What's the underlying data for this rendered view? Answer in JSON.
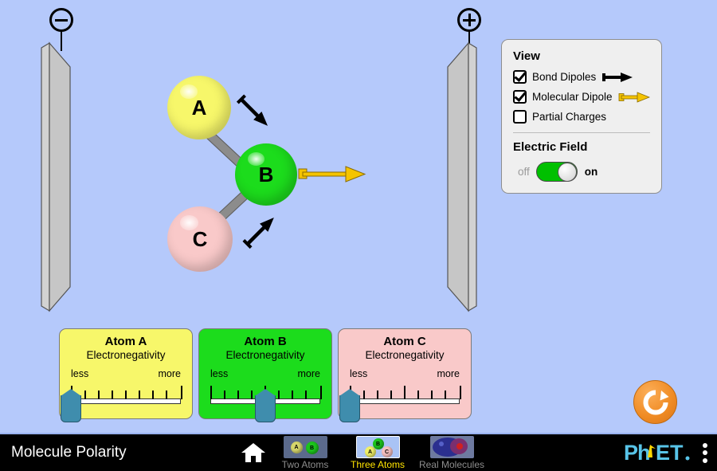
{
  "app": {
    "title": "Molecule Polarity",
    "background_color": "#b5c9fb"
  },
  "field": {
    "negative_plate_sign": "minus-sign",
    "positive_plate_sign": "plus-sign",
    "plate_color": "#c6c6c6"
  },
  "molecule": {
    "atoms": [
      {
        "label": "A",
        "color": "#f7f76a",
        "name": "atom-a"
      },
      {
        "label": "B",
        "color": "#1cdc1c",
        "name": "atom-b"
      },
      {
        "label": "C",
        "color": "#f9c9c9",
        "name": "atom-c"
      }
    ],
    "bond_dipole_color": "#000000",
    "molecular_dipole_color": "#f0b800"
  },
  "view_panel": {
    "title": "View",
    "checkboxes": [
      {
        "label": "Bond Dipoles",
        "checked": true,
        "icon": "bond-dipole-arrow-icon"
      },
      {
        "label": "Molecular Dipole",
        "checked": true,
        "icon": "molecular-dipole-arrow-icon"
      },
      {
        "label": "Partial Charges",
        "checked": false,
        "icon": "none"
      }
    ],
    "electric_field": {
      "title": "Electric Field",
      "off_label": "off",
      "on_label": "on",
      "state": "on"
    }
  },
  "electronegativity_controls": [
    {
      "title": "Atom A",
      "subtitle": "Electronegativity",
      "less_label": "less",
      "more_label": "more",
      "value_percent": 0,
      "panel_color": "#f7f76a",
      "name": "atom-a-electronegativity"
    },
    {
      "title": "Atom B",
      "subtitle": "Electronegativity",
      "less_label": "less",
      "more_label": "more",
      "value_percent": 50,
      "panel_color": "#1cdc1c",
      "name": "atom-b-electronegativity"
    },
    {
      "title": "Atom C",
      "subtitle": "Electronegativity",
      "less_label": "less",
      "more_label": "more",
      "value_percent": 0,
      "panel_color": "#f9c9c9",
      "name": "atom-c-electronegativity"
    }
  ],
  "reset": {
    "icon": "reset-all-icon",
    "color": "#ef8a22"
  },
  "navbar": {
    "title": "Molecule Polarity",
    "home_icon": "home-icon",
    "tabs": [
      {
        "label": "Two Atoms",
        "selected": false,
        "icon": "two-atoms-thumbnail"
      },
      {
        "label": "Three Atoms",
        "selected": true,
        "icon": "three-atoms-thumbnail"
      },
      {
        "label": "Real Molecules",
        "selected": false,
        "icon": "real-molecules-thumbnail"
      }
    ],
    "logo": "phet-logo",
    "menu_icon": "kebab-menu-icon"
  }
}
